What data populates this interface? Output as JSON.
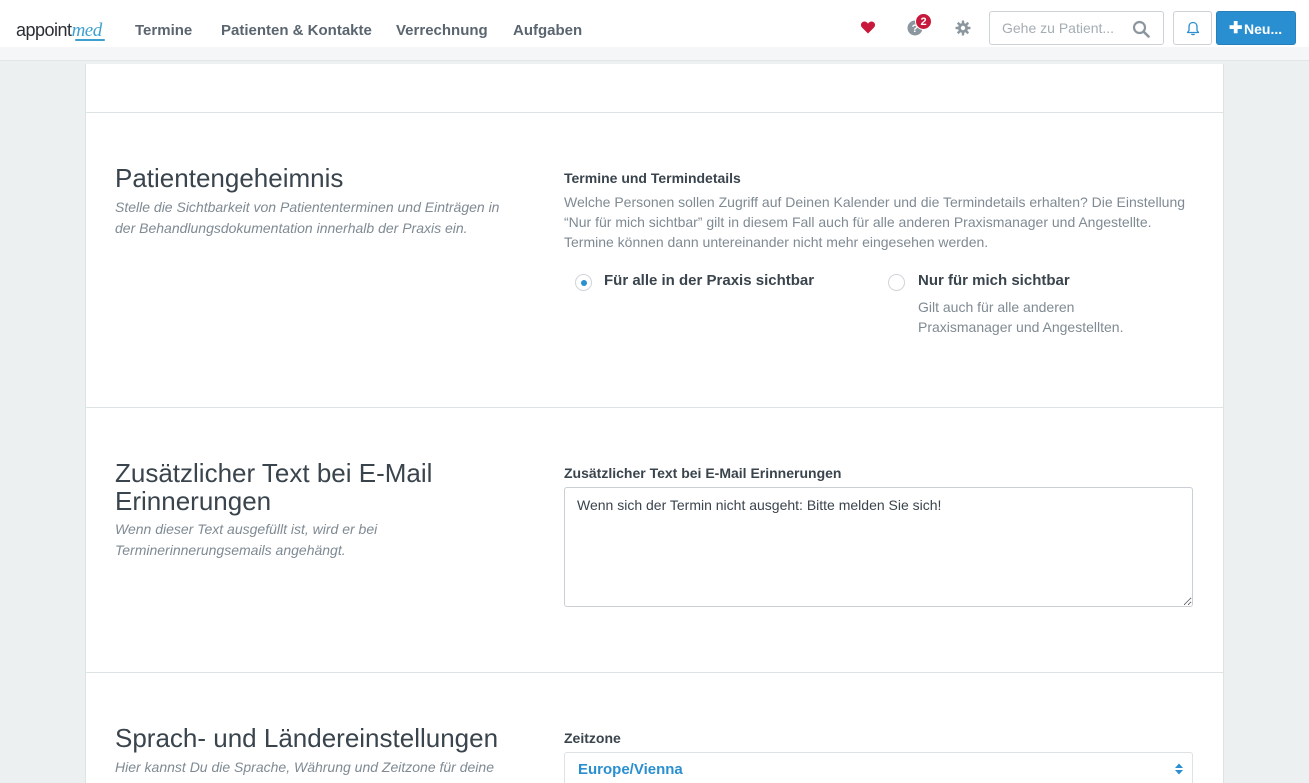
{
  "app": {
    "logo_prefix": "appoint",
    "logo_suffix": "med"
  },
  "nav": {
    "items": [
      "Termine",
      "Patienten & Kontakte",
      "Verrechnung",
      "Aufgaben"
    ]
  },
  "header": {
    "notification_count": "2",
    "search_placeholder": "Gehe zu Patient...",
    "new_button_label": "Neu..."
  },
  "colors": {
    "accent": "#2a8fd0",
    "heart": "#c8193c",
    "badge": "#c8193c"
  },
  "privacy": {
    "title": "Patientengeheimnis",
    "description": "Stelle die Sichtbarkeit von Patiententerminen und Einträgen in der Behandlungsdokumentation innerhalb der Praxis ein.",
    "field_label": "Termine und Termindetails",
    "field_help": "Welche Personen sollen Zugriff auf Deinen Kalender und die Termindetails erhalten? Die Einstellung “Nur für mich sichtbar” gilt in diesem Fall auch für alle anderen Praxismanager und Angestellte. Termine können dann untereinander nicht mehr eingesehen werden.",
    "options": [
      {
        "label": "Für alle in der Praxis sichtbar",
        "checked": true
      },
      {
        "label": "Nur für mich sichtbar",
        "checked": false,
        "help": "Gilt auch für alle anderen Praxismanager und Angestellten."
      }
    ]
  },
  "email": {
    "title": "Zusätzlicher Text bei E-Mail Erinnerungen",
    "description": "Wenn dieser Text ausgefüllt ist, wird er bei Terminerinnerungsemails angehängt.",
    "field_label": "Zusätzlicher Text bei E-Mail Erinnerungen",
    "value": "Wenn sich der Termin nicht ausgeht: Bitte melden Sie sich!"
  },
  "locale": {
    "title": "Sprach- und Ländereinstellungen",
    "description": "Hier kannst Du die Sprache, Währung und Zeitzone für deine",
    "field_label": "Zeitzone",
    "timezone": "Europe/Vienna"
  }
}
